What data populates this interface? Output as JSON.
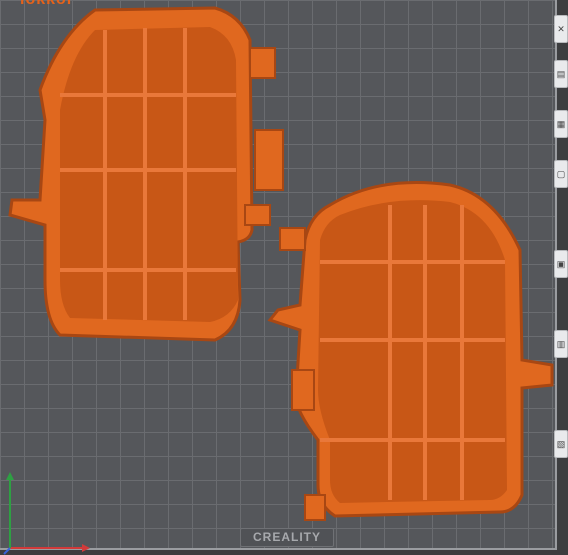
{
  "app": {
    "brand_label": "CREALITY",
    "top_clipped_text": "lokkor"
  },
  "toolbar": {
    "buttons": [
      {
        "name": "close",
        "glyph": "✕"
      },
      {
        "name": "tool-2",
        "glyph": "▤"
      },
      {
        "name": "tool-3",
        "glyph": "▦"
      },
      {
        "name": "tool-4",
        "glyph": "▢"
      },
      {
        "name": "tool-5",
        "glyph": "▣"
      },
      {
        "name": "tool-6",
        "glyph": "▥"
      },
      {
        "name": "tool-7",
        "glyph": "▧"
      }
    ]
  },
  "colors": {
    "model": "#e0681f",
    "model_shadow": "#a84713",
    "grid": "#6a6c70",
    "bed": "#55575b",
    "axis_x": "#d23a3a",
    "axis_y": "#2ea043",
    "axis_z": "#3a64d8"
  },
  "models": [
    {
      "name": "left-housing-part"
    },
    {
      "name": "right-housing-part"
    }
  ]
}
